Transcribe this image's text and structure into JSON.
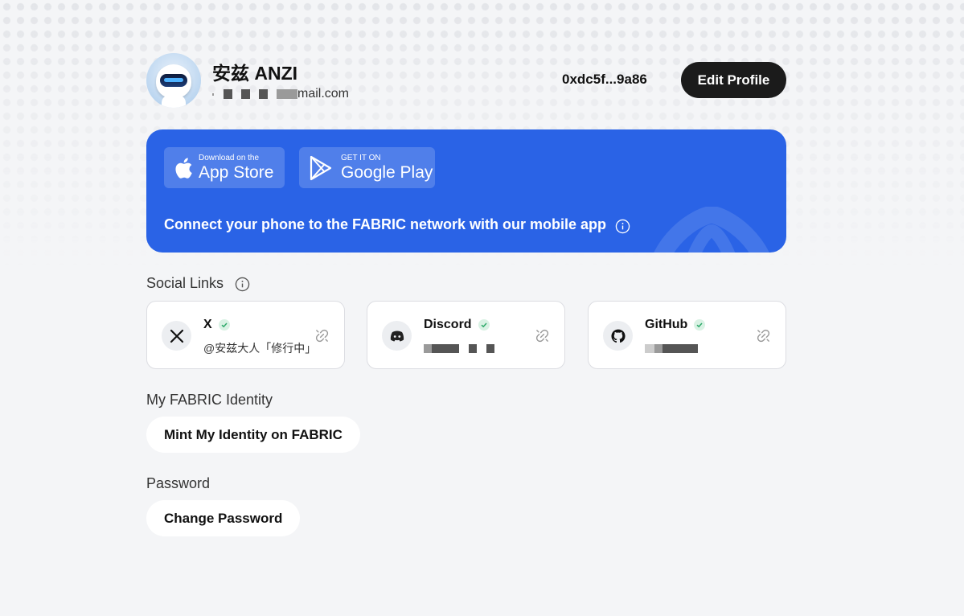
{
  "profile": {
    "name": "安兹 ANZI",
    "email_suffix": "mail.com",
    "wallet_address": "0xdc5f...9a86",
    "edit_label": "Edit Profile"
  },
  "banner": {
    "app_store": {
      "small": "Download on the",
      "big": "App Store"
    },
    "google_play": {
      "small": "GET IT ON",
      "big": "Google Play"
    },
    "message": "Connect your phone to the FABRIC network with our mobile app",
    "color": "#2a63e6"
  },
  "social": {
    "title": "Social Links",
    "links": [
      {
        "name": "X",
        "handle": "@安兹大人「修行中」",
        "icon": "x-logo-icon",
        "verified": true
      },
      {
        "name": "Discord",
        "handle": "",
        "icon": "discord-icon",
        "verified": true
      },
      {
        "name": "GitHub",
        "handle": "",
        "icon": "github-icon",
        "verified": true
      }
    ]
  },
  "identity": {
    "title": "My FABRIC Identity",
    "button_label": "Mint My Identity on FABRIC"
  },
  "password": {
    "title": "Password",
    "button_label": "Change Password"
  }
}
